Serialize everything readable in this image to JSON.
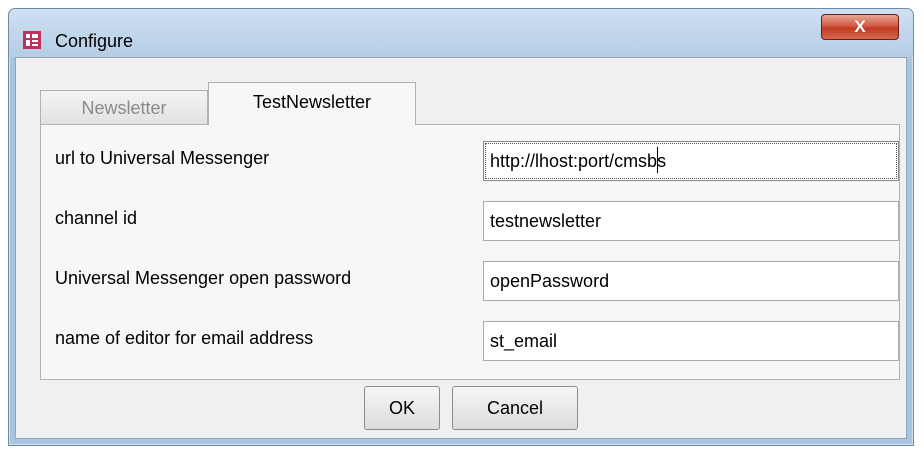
{
  "window": {
    "title": "Configure",
    "close_glyph": "X"
  },
  "tabs": [
    {
      "label": "Newsletter",
      "active": false
    },
    {
      "label": "TestNewsletter",
      "active": true
    }
  ],
  "fields": [
    {
      "label": "url to Universal Messenger",
      "value": "http://lhost:port/cmsbs"
    },
    {
      "label": "channel id",
      "value": "testnewsletter"
    },
    {
      "label": "Universal Messenger open password",
      "value": "openPassword"
    },
    {
      "label": "name of editor for email address",
      "value": "st_email"
    }
  ],
  "buttons": {
    "ok": "OK",
    "cancel": "Cancel"
  },
  "colors": {
    "close_button": "#c23b22",
    "app_icon": "#c0305a"
  }
}
